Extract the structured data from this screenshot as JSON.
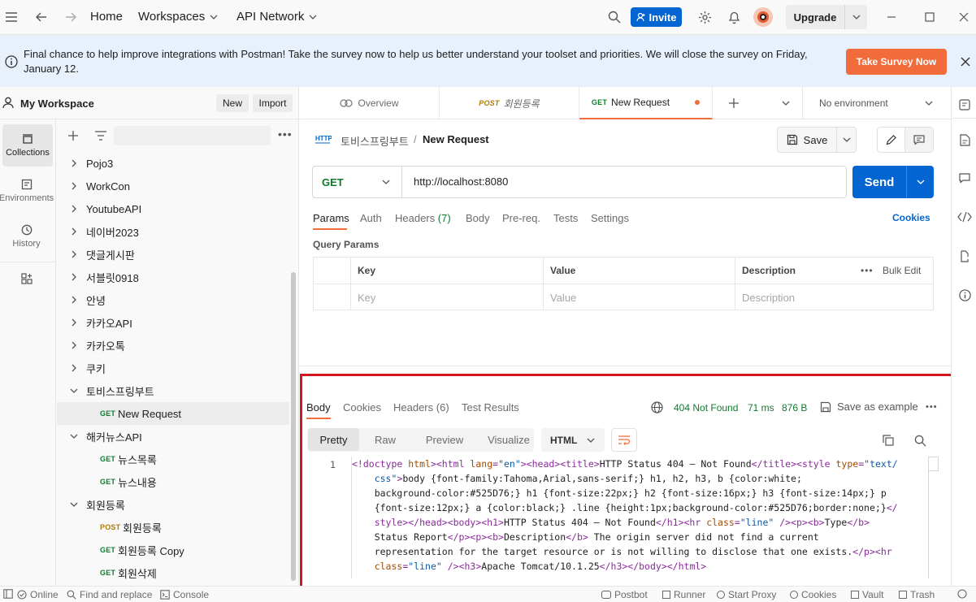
{
  "titlebar": {
    "home": "Home",
    "workspaces": "Workspaces",
    "api_network": "API Network",
    "invite": "Invite",
    "upgrade": "Upgrade"
  },
  "banner": {
    "message": "Final chance to help improve integrations with Postman! Take the survey now to help us better understand your toolset and priorities. We will close the survey on Friday, January 12.",
    "cta": "Take Survey Now",
    "cta_color": "#f26b3a"
  },
  "workspace": {
    "name": "My Workspace",
    "new": "New",
    "import": "Import"
  },
  "rail": [
    {
      "label": "Collections",
      "icon": "collections-icon"
    },
    {
      "label": "Environments",
      "icon": "environments-icon"
    },
    {
      "label": "History",
      "icon": "history-icon"
    }
  ],
  "tree": [
    {
      "label": "Pojo3"
    },
    {
      "label": "WorkCon"
    },
    {
      "label": "YoutubeAPI"
    },
    {
      "label": "네이버2023"
    },
    {
      "label": "댓글게시판"
    },
    {
      "label": "서블릿0918"
    },
    {
      "label": "안녕"
    },
    {
      "label": "카카오API"
    },
    {
      "label": "카카오톡"
    },
    {
      "label": "쿠키"
    },
    {
      "label": "토비스프링부트"
    },
    {
      "label": "New Request",
      "method": "GET"
    },
    {
      "label": "해커뉴스API"
    },
    {
      "label": "뉴스목록",
      "method": "GET"
    },
    {
      "label": "뉴스내용",
      "method": "GET"
    },
    {
      "label": "회원등록"
    },
    {
      "label": "회원등록",
      "method": "POST"
    },
    {
      "label": "회원등록 Copy",
      "method": "GET"
    },
    {
      "label": "회원삭제",
      "method": "GET"
    }
  ],
  "tabs": {
    "overview": "Overview",
    "tab1_method": "POST",
    "tab1_label": "회원등록",
    "tab2_method": "GET",
    "tab2_label": "New Request",
    "environment": "No environment"
  },
  "request": {
    "breadcrumb_parent": "토비스프링부트",
    "breadcrumb_sep": "/",
    "title": "New Request",
    "save": "Save",
    "method": "GET",
    "url": "http://localhost:8080",
    "send": "Send",
    "subtabs": [
      "Params",
      "Auth",
      "Headers",
      "Body",
      "Pre-req.",
      "Tests",
      "Settings"
    ],
    "headers_count": "(7)",
    "cookies": "Cookies",
    "query_params": "Query Params",
    "col_key": "Key",
    "col_value": "Value",
    "col_desc": "Description",
    "bulk_edit": "Bulk Edit",
    "ph_key": "Key",
    "ph_value": "Value",
    "ph_desc": "Description"
  },
  "response": {
    "tabs": [
      "Body",
      "Cookies",
      "Headers",
      "Test Results"
    ],
    "headers_count": "(6)",
    "status": "404 Not Found",
    "time": "71 ms",
    "size": "876 B",
    "save_example": "Save as example",
    "views": [
      "Pretty",
      "Raw",
      "Preview",
      "Visualize"
    ],
    "format": "HTML",
    "line_no": "1"
  },
  "statusbar": {
    "online": "Online",
    "find_replace": "Find and replace",
    "console": "Console",
    "postbot": "Postbot",
    "runner": "Runner",
    "start_proxy": "Start Proxy",
    "cookies": "Cookies",
    "vault": "Vault",
    "trash": "Trash"
  },
  "colors": {
    "accent": "#0265d2",
    "get": "#0d7c2d",
    "post": "#ad7a03",
    "status_ok": "#0d7c2d",
    "highlight_box": "#d3171f"
  }
}
